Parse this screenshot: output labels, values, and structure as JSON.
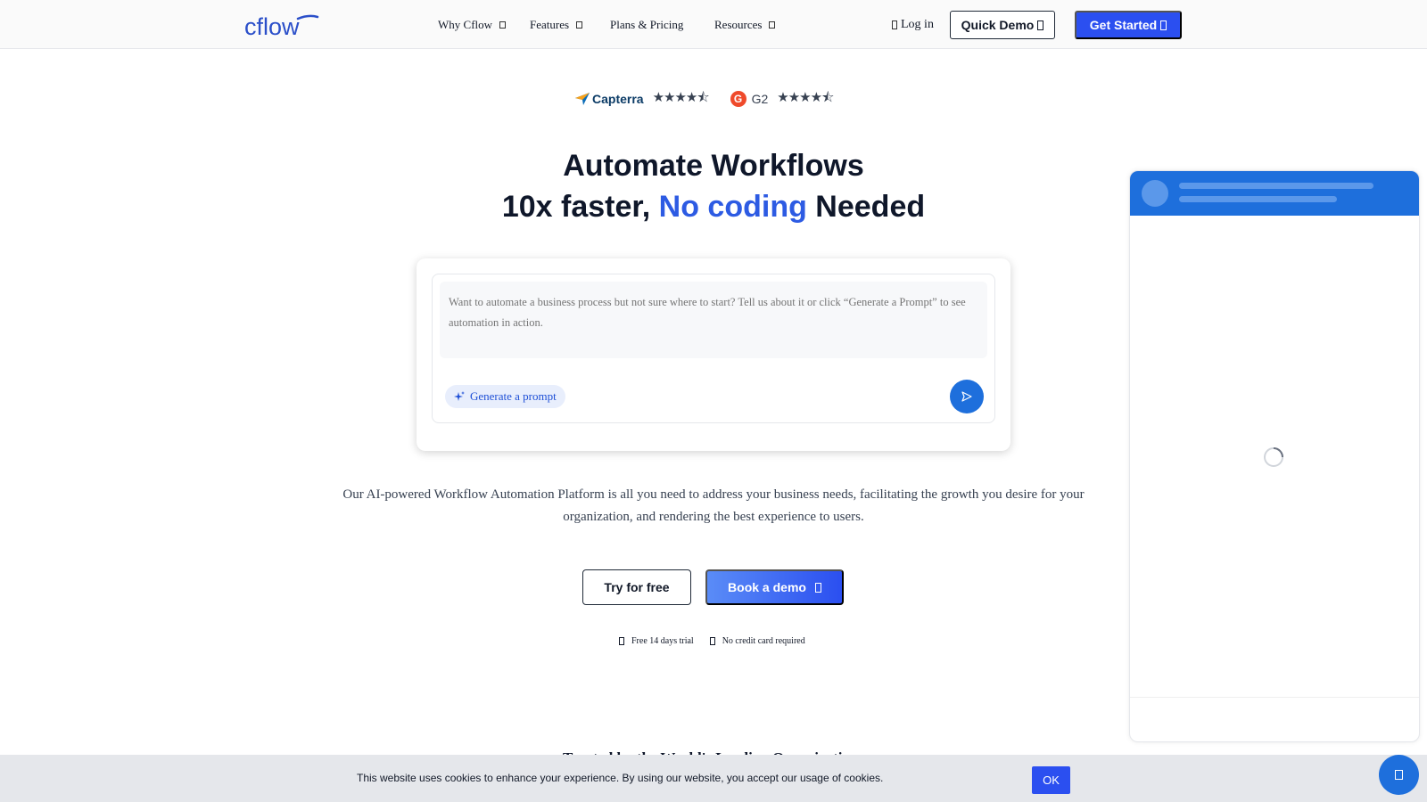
{
  "header": {
    "logo_text": "cflow",
    "nav": [
      {
        "label": "Why Cflow",
        "has_dropdown": true
      },
      {
        "label": "Features",
        "has_dropdown": true
      },
      {
        "label": "Plans & Pricing",
        "has_dropdown": false
      },
      {
        "label": "Resources",
        "has_dropdown": true
      }
    ],
    "login_label": "Log in",
    "quick_demo_label": "Quick Demo",
    "get_started_label": "Get Started"
  },
  "ratings": {
    "capterra_label": "Capterra",
    "capterra_stars": "★★★★⯪",
    "capterra_rating": 4.5,
    "g2_logo": "G",
    "g2_label": "G2",
    "g2_stars": "★★★★⯪",
    "g2_rating": 4.5
  },
  "hero": {
    "line1": "Automate Workflows",
    "line2_pre": "10x faster, ",
    "line2_accent": "No coding",
    "line2_post": " Needed",
    "accent_color": "#2d5be3"
  },
  "prompt": {
    "placeholder": "Want to automate a business process but not sure where to start? Tell us about it or click “Generate a Prompt” to see automation in action.",
    "generate_label": "Generate a prompt"
  },
  "description": "Our AI-powered Workflow Automation Platform is all you need to address your business needs, facilitating the growth you desire for your organization, and rendering the best experience to users.",
  "cta": {
    "try_label": "Try for free",
    "book_label": "Book a demo"
  },
  "perks": [
    "Free 14 days trial",
    "No credit card required"
  ],
  "trusted_heading": "Trusted by the World's Leading Organizations",
  "cookie": {
    "text": "This website uses cookies to enhance your experience. By using our website, you accept our usage of cookies.",
    "ok_label": "OK"
  },
  "colors": {
    "brand_blue": "#2b4ff0",
    "chat_blue": "#1e6fdc"
  }
}
